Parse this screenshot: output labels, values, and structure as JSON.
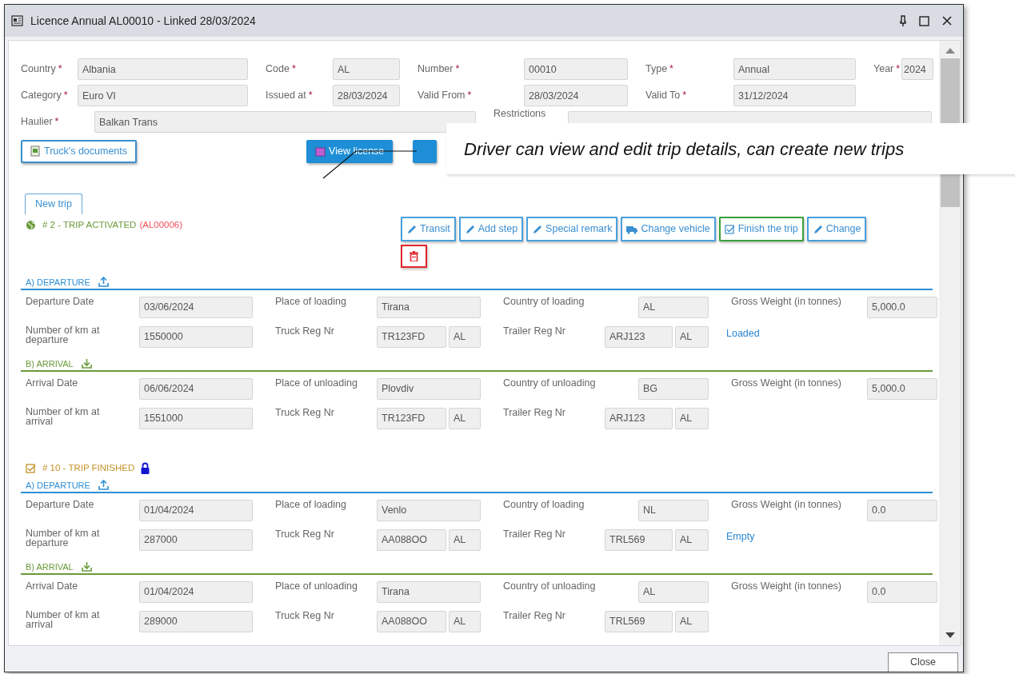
{
  "window": {
    "title": "Licence Annual AL00010 - Linked 28/03/2024"
  },
  "licence_rows": [
    [
      {
        "label": "Country",
        "required_mark": "*",
        "value": "Albania"
      },
      {
        "label": "Code",
        "required_mark": "*",
        "value": "AL"
      },
      {
        "label": "Number",
        "required_mark": "*",
        "value": "00010"
      },
      {
        "label": "Type",
        "required_mark": "*",
        "value": "Annual"
      },
      {
        "label": "Year",
        "required_mark": "*",
        "value": "2024"
      }
    ],
    [
      {
        "label": "Category",
        "required_mark": "*",
        "value": "Euro VI"
      },
      {
        "label": "Issued at",
        "required_mark": "*",
        "value": "28/03/2024"
      },
      {
        "label": "Valid From",
        "required_mark": "*",
        "value": "28/03/2024"
      },
      {
        "label": "Valid To",
        "required_mark": "*",
        "value": "31/12/2024"
      }
    ],
    [
      {
        "label": "Haulier",
        "required_mark": "*",
        "value": "Balkan Trans"
      },
      {
        "label": "Restrictions"
      }
    ]
  ],
  "buttons": [
    {
      "label": "Truck's documents",
      "kind": "documents"
    },
    {
      "label": "View license",
      "kind": "license"
    },
    {
      "kind": "hidden"
    }
  ],
  "callout": {
    "text": "Driver can view and edit trip details, can create new trips"
  },
  "tabs": [
    {
      "label": "New trip",
      "selected": true
    }
  ],
  "trips": [
    {
      "kind": "activated",
      "status": "# 2 - TRIP ACTIVATED",
      "ref": "(AL00006)",
      "locked": false,
      "actions": [
        {
          "label": "Transit",
          "kind": "edit"
        },
        {
          "label": "Add step",
          "kind": "edit"
        },
        {
          "label": "Special remark",
          "kind": "edit"
        },
        {
          "label": "Change vehicle",
          "kind": "truck"
        },
        {
          "label": "Finish the trip",
          "kind": "finish"
        },
        {
          "label": "Change",
          "kind": "edit"
        }
      ],
      "delete": true,
      "sections": [
        {
          "kind": "departure",
          "title": "A) DEPARTURE",
          "date_label": "Departure Date",
          "date": "03/06/2024",
          "place_label": "Place of loading",
          "place": "Tirana",
          "country_label": "Country of loading",
          "country": "AL",
          "weight_label": "Gross Weight (in tonnes)",
          "weight": "5,000.0",
          "km_label": "Number of km at departure",
          "km": "1550000",
          "truck_label": "Truck Reg Nr",
          "truck": "TR123FD",
          "truck_country": "AL",
          "trailer_label": "Trailer Reg Nr",
          "trailer": "ARJ123",
          "trailer_country": "AL",
          "load_status": "Loaded"
        },
        {
          "kind": "arrival",
          "title": "B) ARRIVAL",
          "date_label": "Arrival Date",
          "date": "06/06/2024",
          "place_label": "Place of unloading",
          "place": "Plovdiv",
          "country_label": "Country of unloading",
          "country": "BG",
          "weight_label": "Gross Weight (in tonnes)",
          "weight": "5,000.0",
          "km_label": "Number of km at arrival",
          "km": "1551000",
          "truck_label": "Truck Reg Nr",
          "truck": "TR123FD",
          "truck_country": "AL",
          "trailer_label": "Trailer Reg Nr",
          "trailer": "ARJ123",
          "trailer_country": "AL"
        }
      ]
    },
    {
      "kind": "finished",
      "status": "# 10 - TRIP FINISHED",
      "locked": true,
      "delete": false,
      "sections": [
        {
          "kind": "departure",
          "title": "A) DEPARTURE",
          "date_label": "Departure Date",
          "date": "01/04/2024",
          "place_label": "Place of loading",
          "place": "Venlo",
          "country_label": "Country of loading",
          "country": "NL",
          "weight_label": "Gross Weight (in tonnes)",
          "weight": "0.0",
          "km_label": "Number of km at departure",
          "km": "287000",
          "truck_label": "Truck Reg Nr",
          "truck": "AA088OO",
          "truck_country": "AL",
          "trailer_label": "Trailer Reg Nr",
          "trailer": "TRL569",
          "trailer_country": "AL",
          "load_status": "Empty"
        },
        {
          "kind": "arrival",
          "title": "B) ARRIVAL",
          "date_label": "Arrival Date",
          "date": "01/04/2024",
          "place_label": "Place of unloading",
          "place": "Tirana",
          "country_label": "Country of unloading",
          "country": "AL",
          "weight_label": "Gross Weight (in tonnes)",
          "weight": "0.0",
          "km_label": "Number of km at arrival",
          "km": "289000",
          "truck_label": "Truck Reg Nr",
          "truck": "AA088OO",
          "truck_country": "AL",
          "trailer_label": "Trailer Reg Nr",
          "trailer": "TRL569",
          "trailer_country": "AL"
        }
      ]
    }
  ],
  "footer": {
    "close_button": "Close"
  }
}
